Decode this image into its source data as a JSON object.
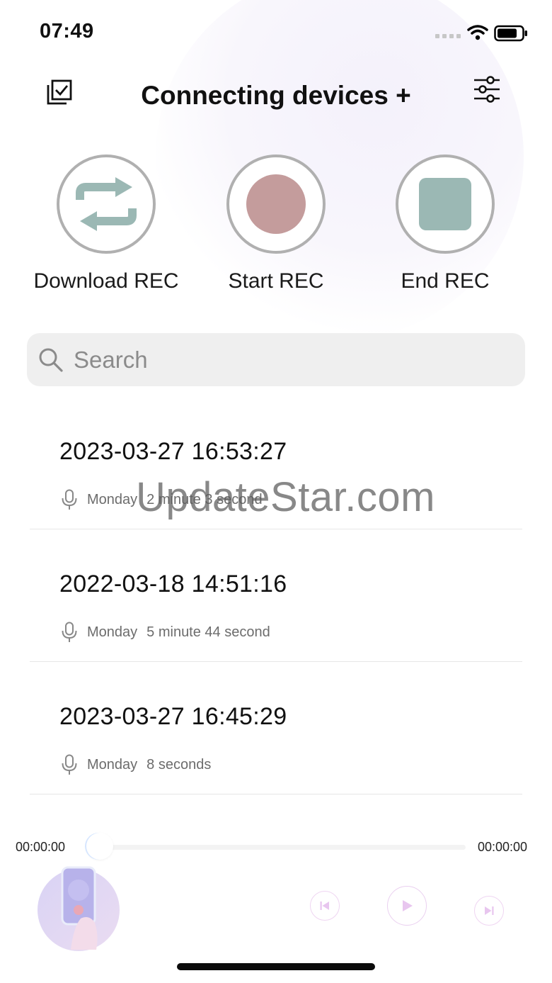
{
  "status_bar": {
    "time": "07:49",
    "icons": [
      "cellular-signal-icon",
      "wifi-icon",
      "battery-icon"
    ]
  },
  "header": {
    "title": "Connecting devices +",
    "left_icon": "select-multiple-icon",
    "right_icon": "settings-sliders-icon"
  },
  "actions": [
    {
      "label": "Download REC",
      "icon": "sync-arrows-icon",
      "color": "#9bb8b4"
    },
    {
      "label": "Start REC",
      "icon": "record-dot-icon",
      "color": "#c49c9c"
    },
    {
      "label": "End REC",
      "icon": "stop-square-icon",
      "color": "#9bb8b4"
    }
  ],
  "search": {
    "placeholder": "Search",
    "value": ""
  },
  "recordings": [
    {
      "timestamp": "2023-03-27 16:53:27",
      "day": "Monday",
      "duration": "2 minute 3 second"
    },
    {
      "timestamp": "2022-03-18 14:51:16",
      "day": "Monday",
      "duration": "5 minute 44 second"
    },
    {
      "timestamp": "2023-03-27 16:45:29",
      "day": "Monday",
      "duration": "8 seconds"
    }
  ],
  "watermark": "UpdateStar.com",
  "player": {
    "current_time": "00:00:00",
    "total_time": "00:00:00",
    "progress": 0,
    "controls": [
      "previous-icon",
      "play-icon",
      "next-icon"
    ],
    "accent": "#e8c6ef"
  }
}
